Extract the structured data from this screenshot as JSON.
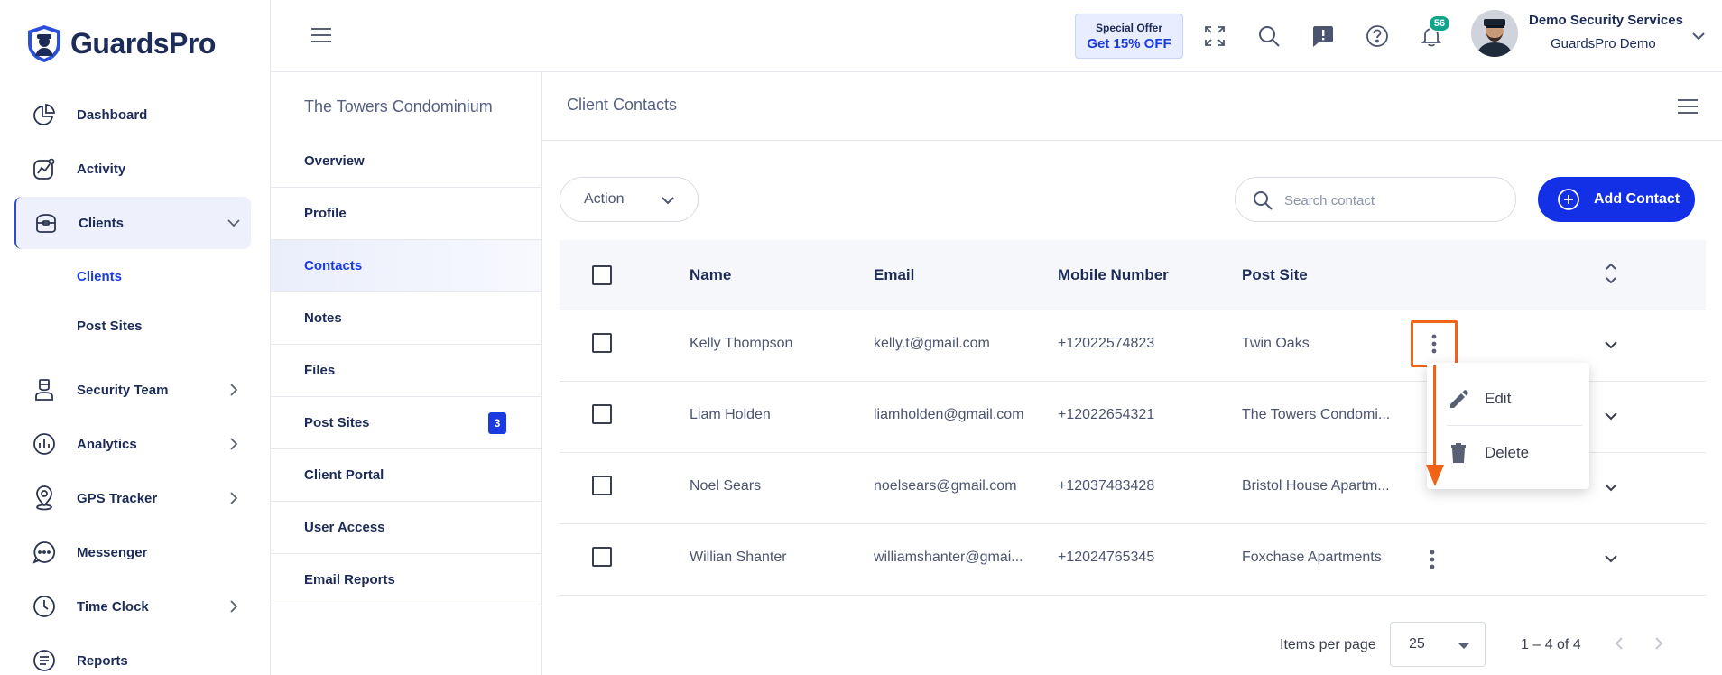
{
  "brand": {
    "name": "GuardsPro"
  },
  "sidebar": {
    "items": [
      {
        "label": "Dashboard",
        "icon": "pie-chart-icon"
      },
      {
        "label": "Activity",
        "icon": "activity-chart-icon"
      },
      {
        "label": "Clients",
        "icon": "briefcase-icon"
      },
      {
        "label": "Security Team",
        "icon": "guard-icon"
      },
      {
        "label": "Analytics",
        "icon": "analytics-icon"
      },
      {
        "label": "GPS Tracker",
        "icon": "location-pin-icon"
      },
      {
        "label": "Messenger",
        "icon": "chat-bubble-icon"
      },
      {
        "label": "Time Clock",
        "icon": "clock-icon"
      },
      {
        "label": "Reports",
        "icon": "report-icon"
      }
    ],
    "sub_items": [
      {
        "label": "Clients"
      },
      {
        "label": "Post Sites"
      }
    ]
  },
  "header": {
    "offer_line1": "Special Offer",
    "offer_line2": "Get 15% OFF",
    "notification_count": "56",
    "user_name": "Demo Security Services",
    "user_org": "GuardsPro Demo"
  },
  "subnav": {
    "title": "The Towers Condominium",
    "items": [
      {
        "label": "Overview"
      },
      {
        "label": "Profile"
      },
      {
        "label": "Contacts"
      },
      {
        "label": "Notes"
      },
      {
        "label": "Files"
      },
      {
        "label": "Post Sites",
        "badge": "3"
      },
      {
        "label": "Client Portal"
      },
      {
        "label": "User Access"
      },
      {
        "label": "Email Reports"
      }
    ]
  },
  "main": {
    "title": "Client Contacts",
    "action_label": "Action",
    "search_placeholder": "Search contact",
    "add_label": "Add Contact",
    "columns": [
      "Name",
      "Email",
      "Mobile Number",
      "Post Site"
    ],
    "rows": [
      {
        "name": "Kelly Thompson",
        "email": "kelly.t@gmail.com",
        "mobile": "+12022574823",
        "post_site": "Twin Oaks"
      },
      {
        "name": "Liam Holden",
        "email": "liamholden@gmail.com",
        "mobile": "+12022654321",
        "post_site": "The Towers Condomi..."
      },
      {
        "name": "Noel Sears",
        "email": "noelsears@gmail.com",
        "mobile": "+12037483428",
        "post_site": "Bristol House Apartm..."
      },
      {
        "name": "Willian Shanter",
        "email": "williamshanter@gmai...",
        "mobile": "+12024765345",
        "post_site": "Foxchase Apartments"
      }
    ],
    "menu": {
      "edit": "Edit",
      "delete": "Delete"
    },
    "pagination": {
      "items_per_page_label": "Items per page",
      "items_per_page": "25",
      "range": "1 – 4 of 4"
    }
  },
  "colors": {
    "accent": "#1330e6",
    "annotation": "#f06418",
    "badge": "#12a38a"
  }
}
